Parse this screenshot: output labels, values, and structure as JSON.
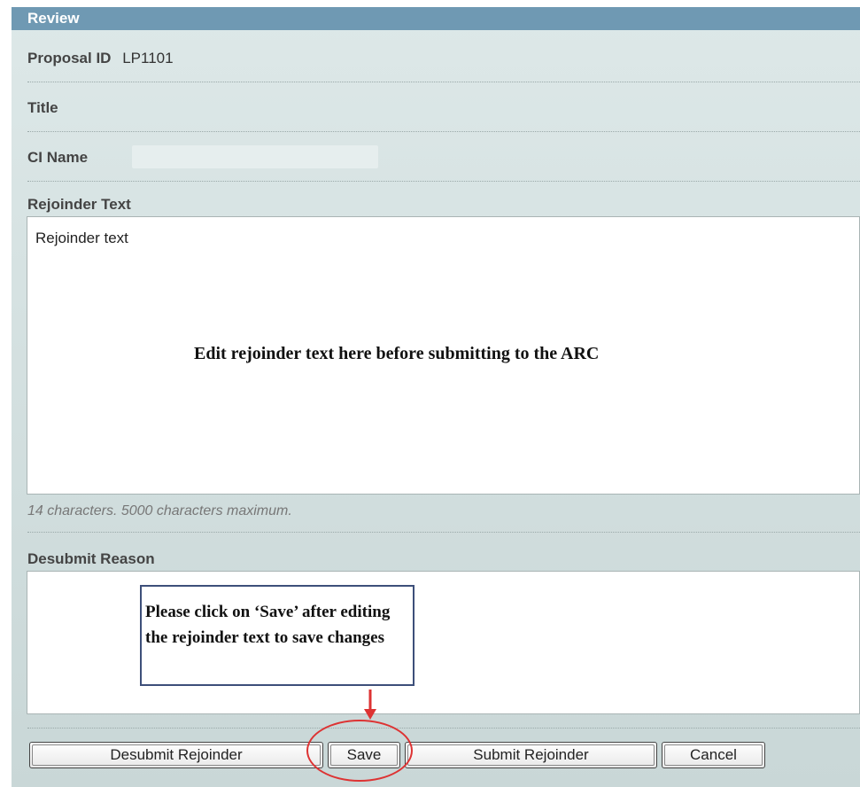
{
  "header": {
    "title": "Review"
  },
  "fields": {
    "proposal_id_label": "Proposal ID",
    "proposal_id_value": "LP1101",
    "title_label": "Title",
    "ci_name_label": "CI Name"
  },
  "rejoinder": {
    "label": "Rejoinder Text",
    "value": "Rejoinder text",
    "annotation": "Edit rejoinder text here before submitting to the ARC",
    "char_hint": "14 characters. 5000 characters maximum."
  },
  "desubmit": {
    "label": "Desubmit Reason",
    "callout_line1": "Please click on ‘Save’ after editing",
    "callout_line2": "the rejoinder text to save changes"
  },
  "buttons": {
    "desubmit": "Desubmit Rejoinder",
    "save": "Save",
    "submit": "Submit Rejoinder",
    "cancel": "Cancel"
  },
  "colors": {
    "header_bg": "#6f99b3",
    "panel_bg": "#d2dfdf",
    "highlight_red": "#dd3333"
  }
}
